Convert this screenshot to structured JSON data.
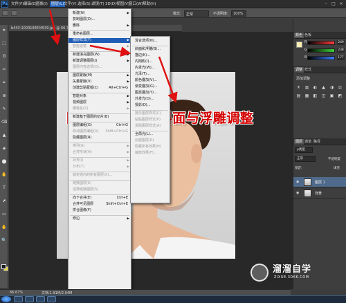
{
  "app": {
    "logo": "Ps",
    "menubar": [
      "文件(F)",
      "编辑(E)",
      "图像(I)",
      "图层(L)",
      "文字(Y)",
      "选择(S)",
      "滤镜(T)",
      "3D(D)",
      "视图(V)",
      "窗口(W)",
      "帮助(H)"
    ],
    "active_menu_index": 3,
    "window_controls": [
      "–",
      "□",
      "×"
    ]
  },
  "options_bar": {
    "mode_label": "模式:",
    "mode_value": "正常",
    "opacity_label": "不透明度:",
    "opacity_value": "100%"
  },
  "document": {
    "tab_title": "b443-10031985f4939.jpg @ 66.7% (图层 1, RGB/8#) *",
    "zoom": "66.67%",
    "doc_info": "文档:1.91M/2.04M"
  },
  "layer_menu": {
    "items": [
      {
        "label": "新建(N)",
        "arrow": true
      },
      {
        "label": "复制图层(D)..."
      },
      {
        "label": "删除",
        "arrow": true
      },
      {
        "sep": true
      },
      {
        "label": "重命名图层..."
      },
      {
        "label": "图层样式(Y)",
        "arrow": true,
        "highlight": true
      },
      {
        "label": "智能滤镜",
        "disabled": true,
        "arrow": true
      },
      {
        "sep": true
      },
      {
        "label": "新建填充图层(W)",
        "arrow": true
      },
      {
        "label": "新建调整图层(J)",
        "arrow": true
      },
      {
        "label": "图层内容选项(O)...",
        "disabled": true
      },
      {
        "sep": true
      },
      {
        "label": "图层蒙版(M)",
        "arrow": true
      },
      {
        "label": "矢量蒙版(V)",
        "arrow": true
      },
      {
        "label": "创建剪贴蒙版(C)",
        "sc": "Alt+Ctrl+G"
      },
      {
        "sep": true
      },
      {
        "label": "智能对象",
        "arrow": true
      },
      {
        "label": "视频图层",
        "arrow": true
      },
      {
        "label": "栅格化(Z)",
        "disabled": true,
        "arrow": true
      },
      {
        "sep": true
      },
      {
        "label": "新建基于图层的切片(B)"
      },
      {
        "sep": true
      },
      {
        "label": "图层编组(G)",
        "sc": "Ctrl+G"
      },
      {
        "label": "取消图层编组(U)",
        "sc": "Shift+Ctrl+G",
        "disabled": true
      },
      {
        "label": "隐藏图层(R)"
      },
      {
        "sep": true
      },
      {
        "label": "排列(A)",
        "disabled": true,
        "arrow": true
      },
      {
        "label": "合并形状(H)",
        "disabled": true,
        "arrow": true
      },
      {
        "sep": true
      },
      {
        "label": "对齐(I)",
        "disabled": true,
        "arrow": true
      },
      {
        "label": "分布(T)",
        "disabled": true,
        "arrow": true
      },
      {
        "sep": true
      },
      {
        "label": "锁定组内的所有图层(X)...",
        "disabled": true
      },
      {
        "sep": true
      },
      {
        "label": "链接图层(K)",
        "disabled": true
      },
      {
        "label": "选择链接图层(S)",
        "disabled": true
      },
      {
        "sep": true
      },
      {
        "label": "向下合并(E)",
        "sc": "Ctrl+E"
      },
      {
        "label": "合并可见图层",
        "sc": "Shift+Ctrl+E"
      },
      {
        "label": "拼合图像(F)"
      },
      {
        "sep": true
      },
      {
        "label": "修边",
        "arrow": true
      }
    ]
  },
  "style_submenu": {
    "items": [
      {
        "label": "混合选项(N)..."
      },
      {
        "sep": true
      },
      {
        "label": "斜面和浮雕(B)..."
      },
      {
        "label": "描边(K)..."
      },
      {
        "label": "内阴影(I)..."
      },
      {
        "label": "内发光(W)..."
      },
      {
        "label": "光泽(T)..."
      },
      {
        "label": "颜色叠加(V)..."
      },
      {
        "label": "渐变叠加(G)..."
      },
      {
        "label": "图案叠加(Y)..."
      },
      {
        "label": "外发光(O)..."
      },
      {
        "label": "投影(D)..."
      },
      {
        "sep": true
      },
      {
        "label": "拷贝图层样式(C)",
        "disabled": true
      },
      {
        "label": "粘贴图层样式(P)",
        "disabled": true
      },
      {
        "label": "清除图层样式(A)",
        "disabled": true
      },
      {
        "sep": true
      },
      {
        "label": "全局光(L)..."
      },
      {
        "label": "创建图层(R)",
        "disabled": true
      },
      {
        "label": "隐藏所有效果(H)",
        "disabled": true
      },
      {
        "label": "缩放效果(F)...",
        "disabled": true
      }
    ]
  },
  "overlay": {
    "title": "图层-图层样式-斜面与浮雕调整"
  },
  "panels": {
    "color_tabs": [
      "颜色",
      "色板"
    ],
    "channels": [
      {
        "label": "R",
        "value": "249",
        "color": "#ff3b3b"
      },
      {
        "label": "G",
        "value": "238",
        "color": "#3bd13b"
      },
      {
        "label": "B",
        "value": "177",
        "color": "#3b7bff"
      }
    ],
    "adjust_tabs": [
      "调整",
      "样式"
    ],
    "adjust_label": "添加调整",
    "layer_tabs": [
      "图层",
      "通道",
      "路径"
    ],
    "kind_label": "ρ类型",
    "blend_mode": "正常",
    "opacity_short": "不透明度",
    "lock_label": "锁定:",
    "fill_short": "填充",
    "layers": [
      {
        "name": "图层 1",
        "selected": true
      },
      {
        "name": "背景",
        "selected": false
      }
    ]
  },
  "watermark": {
    "brand": "溜溜自学",
    "url": "ZIXUE.3D66.COM"
  }
}
